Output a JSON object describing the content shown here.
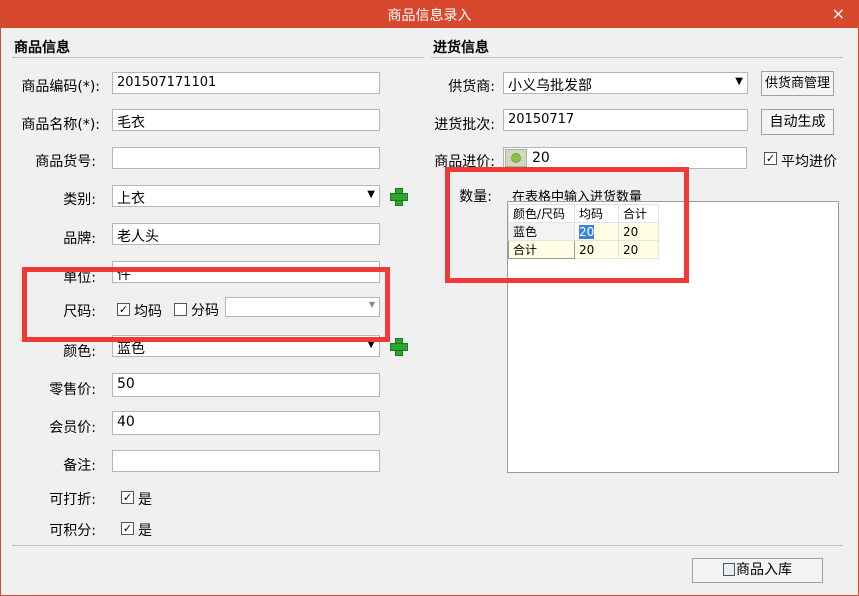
{
  "window": {
    "title": "商品信息录入",
    "close_icon": "×"
  },
  "product_section": {
    "title": "商品信息",
    "code_label": "商品编码(*):",
    "code_value": "201507171101",
    "name_label": "商品名称(*):",
    "name_value": "毛衣",
    "sku_label": "商品货号:",
    "sku_value": "",
    "category_label": "类别:",
    "category_value": "上衣",
    "brand_label": "品牌:",
    "brand_value": "老人头",
    "unit_label": "单位:",
    "unit_value": "件",
    "size_label": "尺码:",
    "size_uniform_label": "均码",
    "size_split_label": "分码",
    "size_select_value": "",
    "color_label": "颜色:",
    "color_value": "蓝色",
    "retail_label": "零售价:",
    "retail_value": "50",
    "member_label": "会员价:",
    "member_value": "40",
    "note_label": "备注:",
    "note_value": "",
    "discount_label": "可打折:",
    "discount_value": "是",
    "points_label": "可积分:",
    "points_value": "是"
  },
  "purchase_section": {
    "title": "进货信息",
    "supplier_label": "供货商:",
    "supplier_value": "小义乌批发部",
    "supplier_btn": "供货商管理",
    "batch_label": "进货批次:",
    "batch_value": "20150717",
    "batch_btn": "自动生成",
    "cost_label": "商品进价:",
    "cost_value": "20",
    "avg_label": "平均进价",
    "qty_label": "数量:",
    "qty_hint": "在表格中输入进货数量",
    "table": {
      "headers": [
        "颜色/尺码",
        "均码",
        "合计"
      ],
      "rows": [
        [
          "蓝色",
          "20",
          "20"
        ],
        [
          "合计",
          "20",
          "20"
        ]
      ]
    }
  },
  "footer": {
    "submit_btn": "商品入库"
  },
  "colors": {
    "titlebar": "#d8482d",
    "highlight": "#f03a3a",
    "plus": "#2fa52f"
  }
}
